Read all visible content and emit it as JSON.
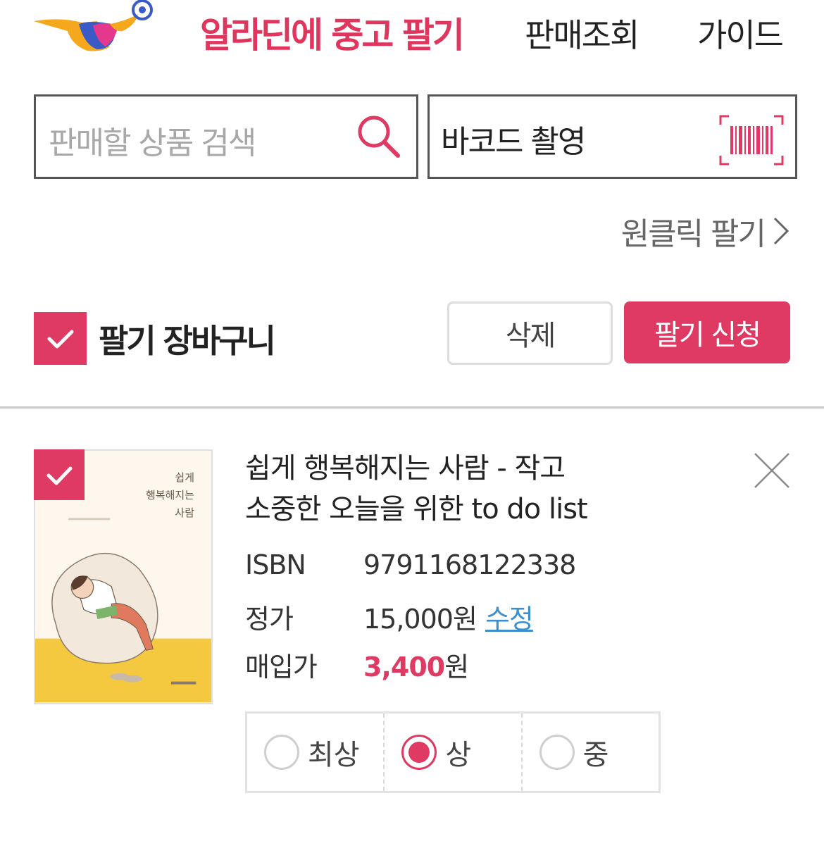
{
  "colors": {
    "accent": "#df3a63",
    "link": "#3a8fd0"
  },
  "header": {
    "title": "알라딘에 중고 팔기",
    "nav": [
      "판매조회",
      "가이드"
    ]
  },
  "search": {
    "placeholder": "판매할 상품 검색"
  },
  "barcode": {
    "label": "바코드 촬영"
  },
  "oneclick": {
    "label": "원클릭 팔기"
  },
  "cart": {
    "title": "팔기 장바구니",
    "select_all_checked": true,
    "delete_label": "삭제",
    "sell_label": "팔기 신청"
  },
  "item": {
    "checked": true,
    "title_line1": "쉽게 행복해지는 사람 - 작고",
    "title_line2": "소중한 오늘을 위한 to do list",
    "isbn_label": "ISBN",
    "isbn": "9791168122338",
    "list_price_label": "정가",
    "list_price": "15,000원",
    "edit_label": "수정",
    "buy_price_label": "매입가",
    "buy_price": "3,400",
    "buy_price_unit": "원",
    "cover_title_lines": [
      "쉽게",
      "행복해지는",
      "사람"
    ],
    "conditions": [
      {
        "label": "최상",
        "selected": false
      },
      {
        "label": "상",
        "selected": true
      },
      {
        "label": "중",
        "selected": false
      }
    ]
  }
}
